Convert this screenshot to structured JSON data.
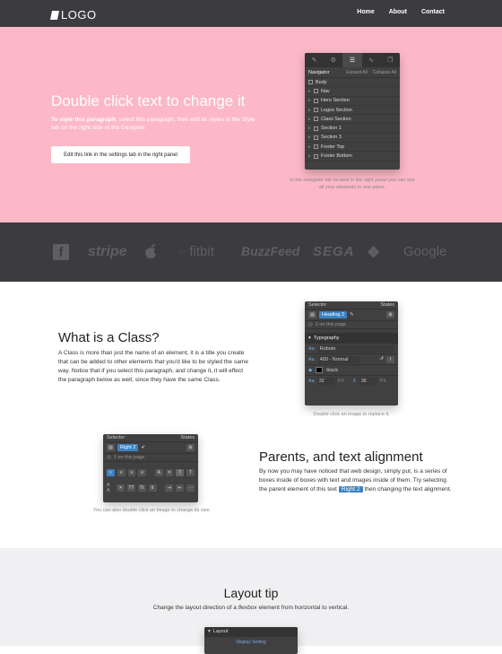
{
  "nav": {
    "logo": "LOGO",
    "links": [
      "Home",
      "About",
      "Contact"
    ]
  },
  "hero": {
    "title": "Double click text to change it",
    "para_bold": "To style this paragraph",
    "para_rest_1": ", select this paragraph, then edit its styles in the ",
    "para_italic": "Style tab",
    "para_rest_2": " on the right side of the Designer.",
    "button": "Edit this link in the settings tab in the right panel",
    "navigator": {
      "title": "Navigator",
      "expand": "Expand All",
      "collapse": "Collapse All",
      "items": [
        "Body",
        "Nav",
        "Hero Section",
        "Logos Section",
        "Class Section",
        "Section 1",
        "Section 3",
        "Footer Top",
        "Footer Bottom"
      ]
    },
    "caption": "In the navigator tab located in the right panel you can see all your elements in one place."
  },
  "logos": [
    "f",
    "stripe",
    "",
    "fitbit",
    "BuzzFeed",
    "SEGA",
    "",
    "Google"
  ],
  "class_section": {
    "title": "What is a Class?",
    "body": "A Class is more than just the name of an element, it is a title you create that can be added to other elements that you'd like to be styled the same way. Notice that if you select this paragraph, and change it, it will effect the paragraph below as well, since they have the same Class.",
    "panel": {
      "selector": "Selector",
      "states": "States",
      "class_tag": "Heading 2",
      "on_page": "2 on this page",
      "typography": "Typography",
      "font": "Roboto",
      "weight": "400 - Normal",
      "color": "black",
      "size": "32",
      "size_unit": "PX",
      "line_height": "36",
      "lh_unit": "PX"
    },
    "caption": "Double click an image to replace it."
  },
  "parents_section": {
    "title": "Parents, and text alignment",
    "body_1": "By now you may have noticed that web design, simply put, is a series of boxes inside of boxes with text and images inside of them. Try selecting the parent element of this text",
    "tag": "Right 2",
    "body_2": "then changing the text alignment.",
    "panel": {
      "selector": "Selector",
      "states": "States",
      "class_tag": "Right 2",
      "on_page": "1 on this page"
    },
    "caption": "You can also double click an image to change its size."
  },
  "layout_tip": {
    "title": "Layout tip",
    "body_1": "Change the layout direction of a",
    "body_italic": "flexbox",
    "body_2": "element from horizontal to vertical.",
    "panel_title": "Layout",
    "panel_sub": "Display Setting"
  }
}
